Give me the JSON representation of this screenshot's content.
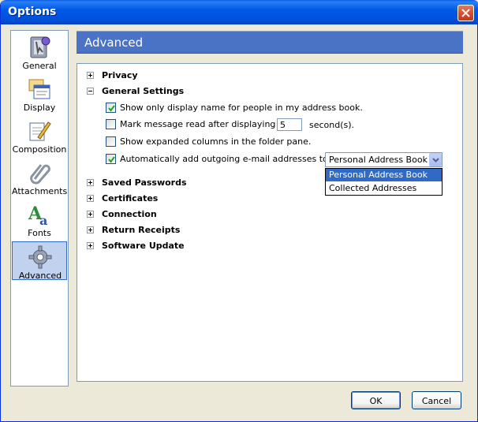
{
  "window": {
    "title": "Options"
  },
  "categories": [
    {
      "label": "General",
      "icon": "general-icon"
    },
    {
      "label": "Display",
      "icon": "display-icon"
    },
    {
      "label": "Composition",
      "icon": "composition-icon"
    },
    {
      "label": "Attachments",
      "icon": "attachments-icon"
    },
    {
      "label": "Fonts",
      "icon": "fonts-icon"
    },
    {
      "label": "Advanced",
      "icon": "advanced-icon",
      "selected": true
    }
  ],
  "pane": {
    "title": "Advanced"
  },
  "sections": [
    {
      "label": "Privacy",
      "expanded": false
    },
    {
      "label": "General Settings",
      "expanded": true
    },
    {
      "label": "Saved Passwords",
      "expanded": false
    },
    {
      "label": "Certificates",
      "expanded": false
    },
    {
      "label": "Connection",
      "expanded": false
    },
    {
      "label": "Return Receipts",
      "expanded": false
    },
    {
      "label": "Software Update",
      "expanded": false
    }
  ],
  "general_settings": {
    "options": [
      {
        "label": "Show only display name for people in my address book.",
        "checked": true
      },
      {
        "label": "Mark message read after displaying for",
        "checked": false
      },
      {
        "label": "Show expanded columns in the folder pane.",
        "checked": false
      },
      {
        "label": "Automatically add outgoing e-mail addresses to my:",
        "checked": true
      }
    ],
    "mark_read_seconds": "5",
    "seconds_label": "second(s).",
    "address_book_select": {
      "value": "Personal Address Book",
      "options": [
        "Personal Address Book",
        "Collected Addresses"
      ],
      "highlighted": "Personal Address Book"
    }
  },
  "buttons": {
    "ok": "OK",
    "cancel": "Cancel"
  },
  "colors": {
    "title_bar": "#0058e6",
    "header_bar": "#4a73c5",
    "selection": "#316ac5",
    "window_bg": "#ece9d8"
  }
}
